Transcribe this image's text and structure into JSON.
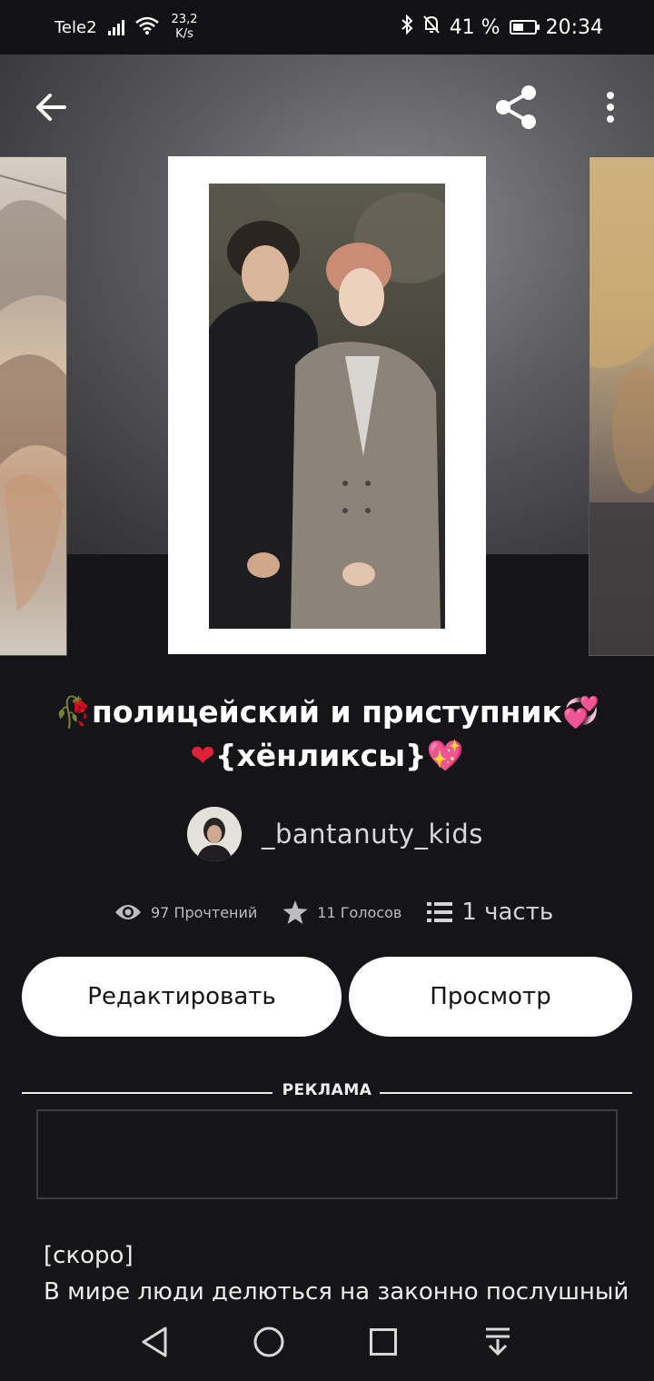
{
  "status_bar": {
    "carrier": "Tele2",
    "speed_value": "23,2",
    "speed_unit": "K/s",
    "battery_percent": "41 %",
    "time": "20:34"
  },
  "toolbar": {
    "back_icon": "arrow-left-icon",
    "share_icon": "share-icon",
    "more_icon": "more-vertical-icon"
  },
  "story": {
    "title_line1": "полицейский и приступник",
    "title_line2": "{хёнликсы}",
    "author": "_bantanuty_kids",
    "reads": "97 Прочтений",
    "votes": "11 Голосов",
    "parts": "1 часть"
  },
  "actions": {
    "edit_label": "Редактировать",
    "view_label": "Просмотр"
  },
  "ad": {
    "label": "РЕКЛАМА"
  },
  "description": {
    "line1": "[скоро]",
    "line2": "В мире люди делються на законно послушный"
  },
  "colors": {
    "background": "#151417",
    "button_bg": "#ffffff",
    "button_text": "#141414"
  }
}
